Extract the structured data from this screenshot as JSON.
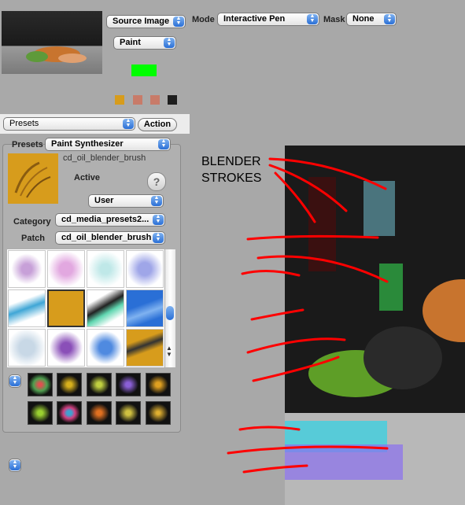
{
  "top_left": {
    "source_popup": "Source Image",
    "paint_popup": "Paint",
    "colors": {
      "current": "#00ff00",
      "swatches": [
        "#d79c1c",
        "#c87b69",
        "#c87b69",
        "#1e1e1e"
      ]
    }
  },
  "toolbar": {
    "mode_label": "Mode",
    "mode_value": "Interactive Pen",
    "mask_label": "Mask",
    "mask_value": "None"
  },
  "presets_bar": {
    "presets_popup": "Presets",
    "action_button": "Action"
  },
  "panel": {
    "presets_label": "Presets",
    "presets_value": "Paint Synthesizer",
    "brush_name": "cd_oil_blender_brush",
    "active_label": "Active",
    "help_glyph": "?",
    "user_popup": "User",
    "category_label": "Category",
    "category_value": "cd_media_presets2...",
    "patch_label": "Patch",
    "patch_value": "cd_oil_blender_brush"
  },
  "annotation": {
    "line1": "BLENDER",
    "line2": "STROKES",
    "color": "#ff0000"
  }
}
